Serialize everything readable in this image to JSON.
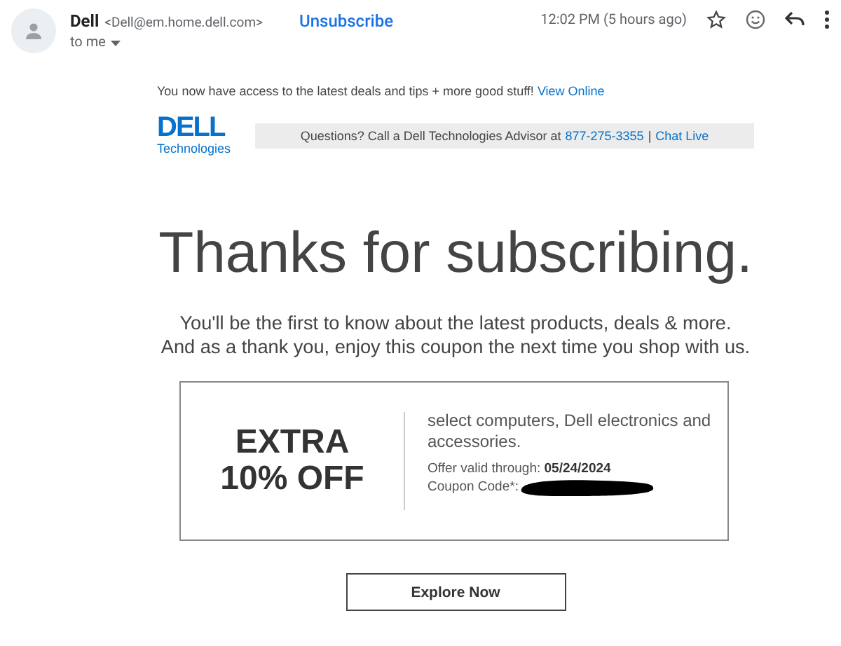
{
  "header": {
    "sender_name": "Dell",
    "sender_email": "<Dell@em.home.dell.com>",
    "unsubscribe": "Unsubscribe",
    "recipient": "to me",
    "time": "12:02 PM (5 hours ago)",
    "starred": false
  },
  "body": {
    "preheader": "You now have access to the latest deals and tips + more good stuff!",
    "view_online": "View Online",
    "logo": {
      "wordmark": "DELL",
      "subtitle": "Technologies"
    },
    "help_bar": {
      "text": "Questions? Call a Dell Technologies Advisor at",
      "phone": "877-275-3355",
      "separator": "|",
      "chat": "Chat Live"
    },
    "heading": "Thanks for subscribing.",
    "intro": [
      "You'll be the first to know about the latest products, deals & more.",
      "And as a thank you, enjoy this coupon the next time you shop with us."
    ],
    "coupon": {
      "offer": [
        "EXTRA",
        "10% OFF"
      ],
      "description": "select computers, Dell electronics and accessories.",
      "valid_label": "Offer valid through:",
      "valid_date": "05/24/2024",
      "code_label": "Coupon Code*:"
    },
    "cta": "Explore Now"
  }
}
